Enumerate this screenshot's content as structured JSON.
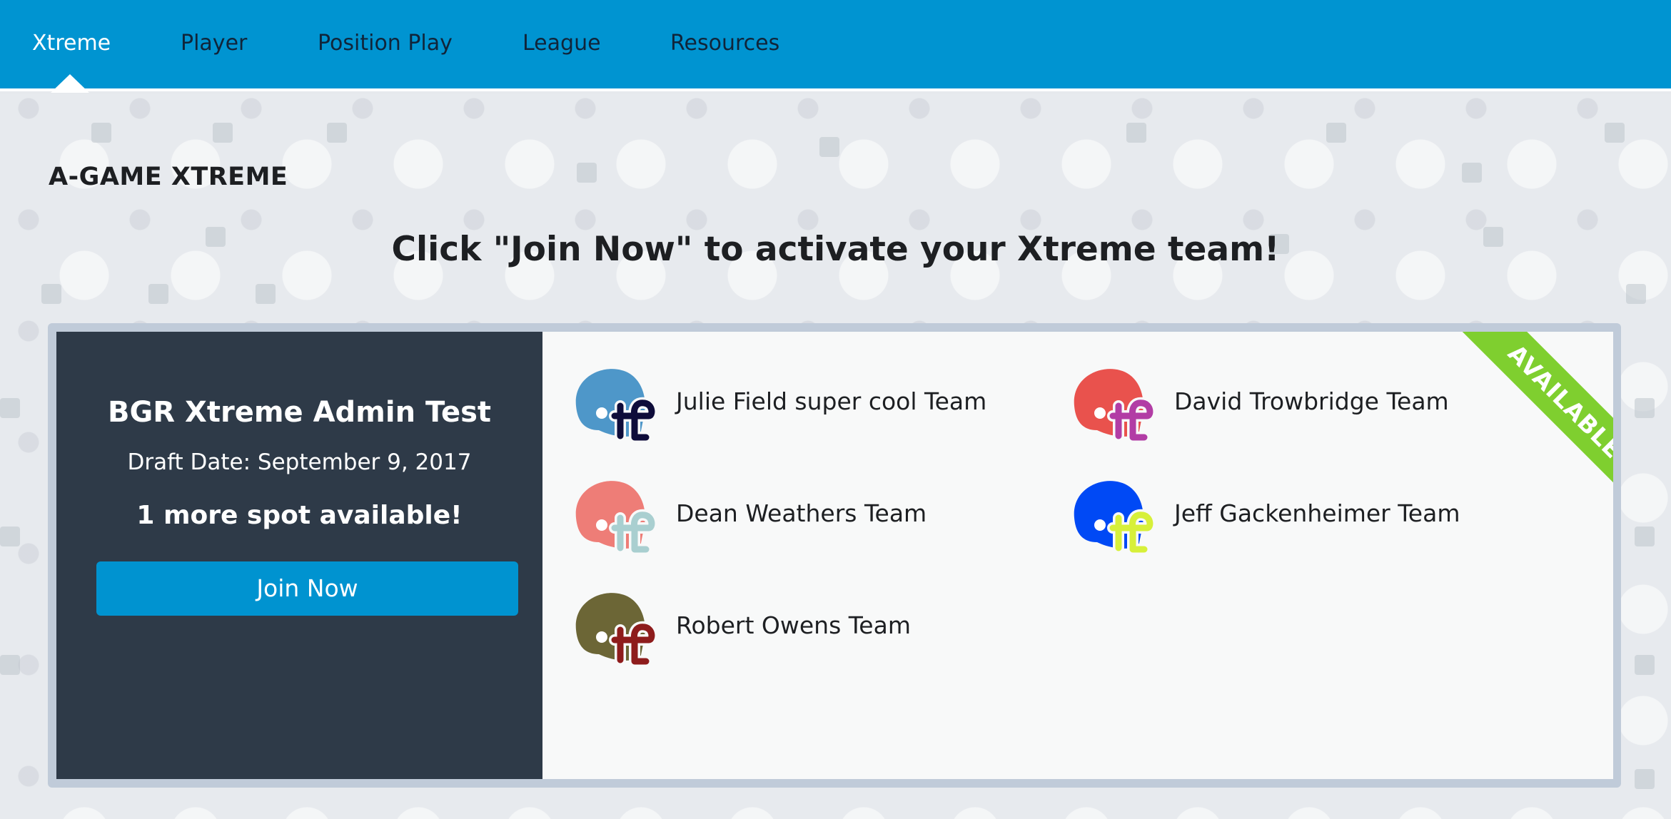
{
  "nav": {
    "items": [
      {
        "label": "Xtreme",
        "active": true
      },
      {
        "label": "Player"
      },
      {
        "label": "Position Play"
      },
      {
        "label": "League"
      },
      {
        "label": "Resources"
      }
    ]
  },
  "page": {
    "heading": "A-GAME XTREME",
    "cta": "Click \"Join Now\" to activate your Xtreme team!"
  },
  "league": {
    "name": "BGR Xtreme Admin Test",
    "draft_date": "Draft Date: September 9, 2017",
    "spots_text": "1 more spot available!",
    "join_label": "Join Now",
    "ribbon_label": "AVAILABLE!"
  },
  "teams": [
    {
      "name": "Julie Field super cool Team",
      "icon": "football-helmet-icon",
      "shell_color": "#4e97c9",
      "logo_color": "#0e0c3a"
    },
    {
      "name": "David Trowbridge Team",
      "icon": "football-helmet-icon",
      "shell_color": "#e9524d",
      "logo_color": "#b23da5"
    },
    {
      "name": "Dean Weathers Team",
      "icon": "football-helmet-icon",
      "shell_color": "#ee7d77",
      "logo_color": "#a9cfd0"
    },
    {
      "name": "Jeff Gackenheimer Team",
      "icon": "football-helmet-icon",
      "shell_color": "#0049f5",
      "logo_color": "#d7f03a"
    },
    {
      "name": "Robert Owens Team",
      "icon": "football-helmet-icon",
      "shell_color": "#6c6636",
      "logo_color": "#8e1c1c"
    }
  ],
  "colors": {
    "nav_bg": "#0094d1",
    "card_left_bg": "#2e3a48",
    "button_bg": "#0093d0",
    "ribbon_bg": "#7fcf2f"
  }
}
